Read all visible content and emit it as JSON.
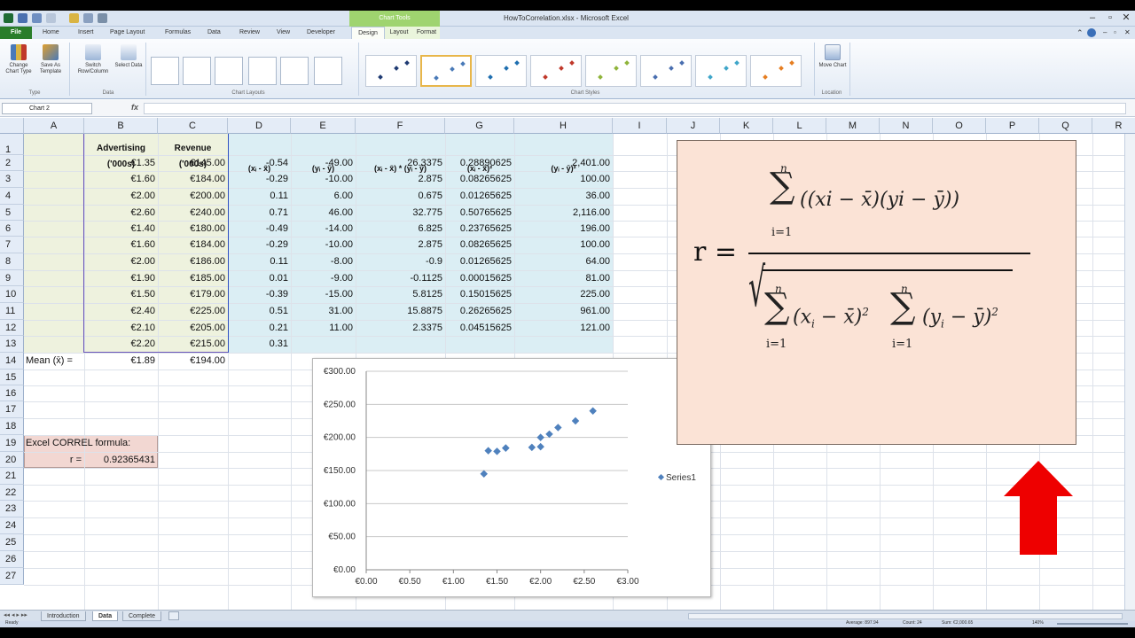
{
  "window": {
    "title": "HowToCorrelation.xlsx - Microsoft Excel",
    "context_group": "Chart Tools"
  },
  "tabs": [
    "File",
    "Home",
    "Insert",
    "Page Layout",
    "Formulas",
    "Data",
    "Review",
    "View",
    "Developer",
    "Design",
    "Layout",
    "Format"
  ],
  "active_tab": "Design",
  "ribbon": {
    "change_chart_type": "Change Chart Type",
    "save_as_template": "Save As Template",
    "switch_row_column": "Switch Row/Column",
    "select_data": "Select Data",
    "move_chart": "Move Chart",
    "groups": {
      "type": "Type",
      "data": "Data",
      "layouts": "Chart Layouts",
      "styles": "Chart Styles",
      "location": "Location"
    },
    "style_colors": [
      "#1f3b73",
      "#4a7ab8",
      "#1f6fb0",
      "#c0392b",
      "#8fb43a",
      "#4a6fb0",
      "#3fa6c9",
      "#e67e22"
    ]
  },
  "formula_bar": {
    "name_box": "Chart 2",
    "fx": "fx",
    "value": ""
  },
  "columns": [
    "A",
    "B",
    "C",
    "D",
    "E",
    "F",
    "G",
    "H",
    "I",
    "J",
    "K",
    "L",
    "M",
    "N",
    "O",
    "P",
    "Q",
    "R"
  ],
  "rows": [
    "1",
    "2",
    "3",
    "4",
    "5",
    "6",
    "7",
    "8",
    "9",
    "10",
    "11",
    "12",
    "13",
    "14",
    "15",
    "16",
    "17",
    "18",
    "19",
    "20",
    "21",
    "22",
    "23",
    "24",
    "25",
    "26",
    "27"
  ],
  "headers": {
    "b": "Advertising ('000s)",
    "b1": "Advertising",
    "b2": "('000s)",
    "c1": "Revenue",
    "c2": "('000s)",
    "d": "(xᵢ - x̄)",
    "e": "(yᵢ - ȳ)",
    "f": "(xᵢ - x̄) * (yᵢ - ȳ)",
    "g": "(xᵢ - x̄)²",
    "h": "(yᵢ - ȳ)²"
  },
  "table": [
    {
      "b": "€1.35",
      "c": "€145.00",
      "d": "-0.54",
      "e": "-49.00",
      "f": "26.3375",
      "g": "0.28890625",
      "h": "2,401.00"
    },
    {
      "b": "€1.60",
      "c": "€184.00",
      "d": "-0.29",
      "e": "-10.00",
      "f": "2.875",
      "g": "0.08265625",
      "h": "100.00"
    },
    {
      "b": "€2.00",
      "c": "€200.00",
      "d": "0.11",
      "e": "6.00",
      "f": "0.675",
      "g": "0.01265625",
      "h": "36.00"
    },
    {
      "b": "€2.60",
      "c": "€240.00",
      "d": "0.71",
      "e": "46.00",
      "f": "32.775",
      "g": "0.50765625",
      "h": "2,116.00"
    },
    {
      "b": "€1.40",
      "c": "€180.00",
      "d": "-0.49",
      "e": "-14.00",
      "f": "6.825",
      "g": "0.23765625",
      "h": "196.00"
    },
    {
      "b": "€1.60",
      "c": "€184.00",
      "d": "-0.29",
      "e": "-10.00",
      "f": "2.875",
      "g": "0.08265625",
      "h": "100.00"
    },
    {
      "b": "€2.00",
      "c": "€186.00",
      "d": "0.11",
      "e": "-8.00",
      "f": "-0.9",
      "g": "0.01265625",
      "h": "64.00"
    },
    {
      "b": "€1.90",
      "c": "€185.00",
      "d": "0.01",
      "e": "-9.00",
      "f": "-0.1125",
      "g": "0.00015625",
      "h": "81.00"
    },
    {
      "b": "€1.50",
      "c": "€179.00",
      "d": "-0.39",
      "e": "-15.00",
      "f": "5.8125",
      "g": "0.15015625",
      "h": "225.00"
    },
    {
      "b": "€2.40",
      "c": "€225.00",
      "d": "0.51",
      "e": "31.00",
      "f": "15.8875",
      "g": "0.26265625",
      "h": "961.00"
    },
    {
      "b": "€2.10",
      "c": "€205.00",
      "d": "0.21",
      "e": "11.00",
      "f": "2.3375",
      "g": "0.04515625",
      "h": "121.00"
    },
    {
      "b": "€2.20",
      "c": "€215.00",
      "d": "0.31",
      "e": "",
      "f": "",
      "g": "",
      "h": ""
    }
  ],
  "mean": {
    "label": "Mean (x̄) =",
    "b": "€1.89",
    "c": "€194.00"
  },
  "correl": {
    "label": "Excel CORREL formula:",
    "r_label": "r =",
    "r_value": "0.92365431"
  },
  "formula": {
    "lhs": "r =",
    "n": "n",
    "i1": "i=1",
    "numerator": "((xi − x̄)(yi − ȳ))",
    "den1": "(x",
    "den1_sub": "i",
    "den1_tail": " − x̄)",
    "den2": "(y",
    "den2_sub": "i",
    "den2_tail": " − ȳ)",
    "sq": "2",
    "sigma": "∑",
    "sqrt": "√"
  },
  "sheet_tabs": [
    "Introduction",
    "Data",
    "Complete"
  ],
  "active_sheet": "Data",
  "status": {
    "ready": "Ready",
    "average": "Average: 897.94",
    "count": "Count: 24",
    "sum": "Sum: €2,000.65",
    "zoom": "140%"
  },
  "chart_data": {
    "type": "scatter",
    "title": "",
    "xlabel": "",
    "ylabel": "",
    "xlim": [
      0,
      3
    ],
    "ylim": [
      0,
      300
    ],
    "x_ticks": [
      "€0.00",
      "€0.50",
      "€1.00",
      "€1.50",
      "€2.00",
      "€2.50",
      "€3.00"
    ],
    "y_ticks": [
      "€0.00",
      "€50.00",
      "€100.00",
      "€150.00",
      "€200.00",
      "€250.00",
      "€300.00"
    ],
    "legend": "right",
    "grid": true,
    "marker_color": "#4f81bd",
    "series": [
      {
        "name": "Series1",
        "x": [
          1.35,
          1.6,
          2.0,
          2.6,
          1.4,
          1.6,
          2.0,
          1.9,
          1.5,
          2.4,
          2.1,
          2.2
        ],
        "y": [
          145,
          184,
          200,
          240,
          180,
          184,
          186,
          185,
          179,
          225,
          205,
          215
        ]
      }
    ]
  }
}
